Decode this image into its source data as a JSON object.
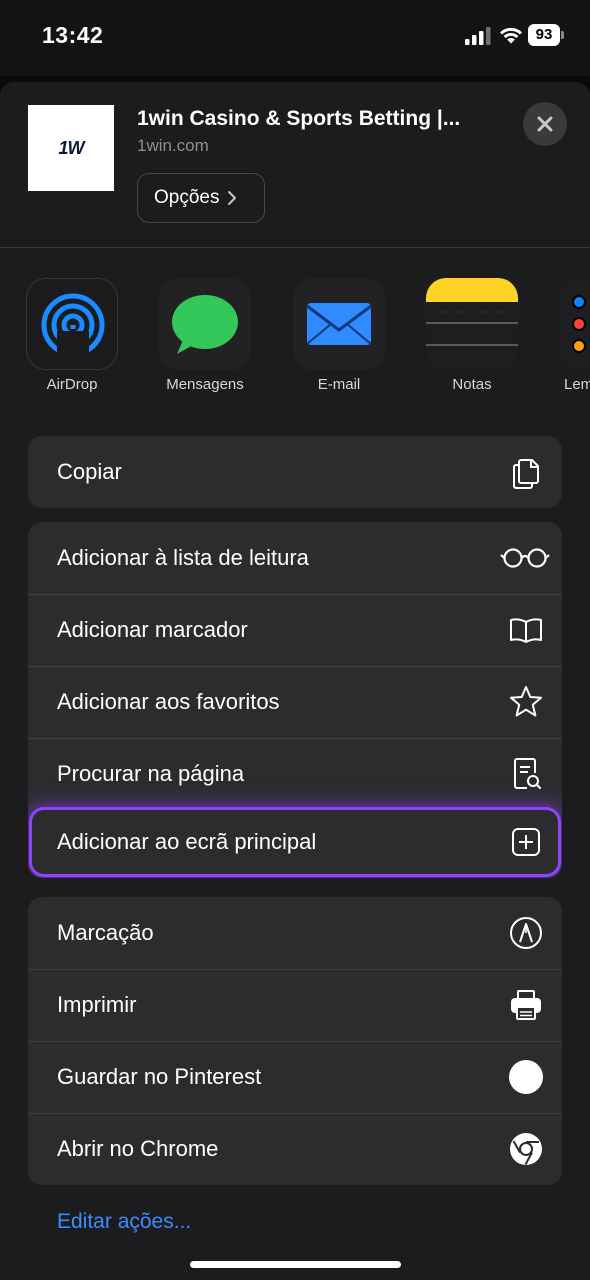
{
  "status_bar": {
    "time": "13:42",
    "battery": "93"
  },
  "header": {
    "thumbnail_logo": "1W",
    "title": "1win Casino & Sports Betting |...",
    "url": "1win.com",
    "options_label": "Opções"
  },
  "apps": [
    {
      "label": "AirDrop",
      "icon": "airdrop-icon"
    },
    {
      "label": "Mensagens",
      "icon": "messages-icon"
    },
    {
      "label": "E-mail",
      "icon": "mail-icon"
    },
    {
      "label": "Notas",
      "icon": "notes-icon"
    },
    {
      "label": "Lembretes",
      "icon": "reminders-icon"
    }
  ],
  "actions_group1": [
    {
      "label": "Copiar",
      "icon": "copy-icon"
    }
  ],
  "actions_group2": [
    {
      "label": "Adicionar à lista de leitura",
      "icon": "glasses-icon"
    },
    {
      "label": "Adicionar marcador",
      "icon": "book-icon"
    },
    {
      "label": "Adicionar aos favoritos",
      "icon": "star-icon"
    },
    {
      "label": "Procurar na página",
      "icon": "find-in-page-icon"
    },
    {
      "label": "Adicionar ao ecrã principal",
      "icon": "plus-square-icon"
    }
  ],
  "actions_group3": [
    {
      "label": "Marcação",
      "icon": "markup-icon"
    },
    {
      "label": "Imprimir",
      "icon": "printer-icon"
    },
    {
      "label": "Guardar no Pinterest",
      "icon": "pinterest-icon"
    },
    {
      "label": "Abrir no Chrome",
      "icon": "chrome-icon"
    }
  ],
  "edit_actions_label": "Editar ações...",
  "colors": {
    "accent": "#3b8dff",
    "highlight": "#8e44ff",
    "sheet": "#1c1c1e",
    "row": "#2c2c2e"
  }
}
